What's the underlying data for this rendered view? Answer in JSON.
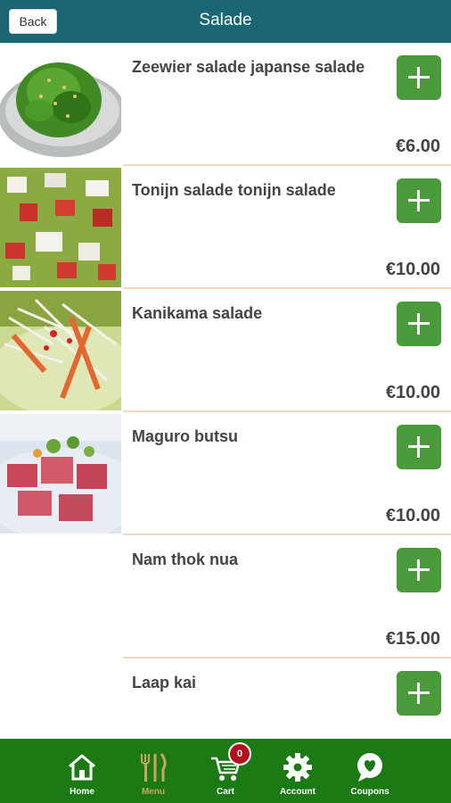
{
  "header": {
    "back_label": "Back",
    "title": "Salade",
    "bar_color": "#1b6675"
  },
  "items": [
    {
      "name": "Zeewier salade japanse salade",
      "price": "€6.00",
      "image": "seaweed-salad-image"
    },
    {
      "name": "Tonijn salade tonijn salade",
      "price": "€10.00",
      "image": "tuna-salad-image"
    },
    {
      "name": "Kanikama salade",
      "price": "€10.00",
      "image": "kanikama-salad-image"
    },
    {
      "name": "Maguro butsu",
      "price": "€10.00",
      "image": "maguro-butsu-image"
    },
    {
      "name": "Nam thok nua",
      "price": "€15.00"
    },
    {
      "name": "Laap kai",
      "price": ""
    }
  ],
  "nav": {
    "bar_color": "#1b7a14",
    "active_color": "#c9a46b",
    "tabs": [
      {
        "label": "Home",
        "icon": "home-icon"
      },
      {
        "label": "Menu",
        "icon": "fork-knife-icon"
      },
      {
        "label": "Cart",
        "icon": "cart-icon",
        "badge": "0"
      },
      {
        "label": "Account",
        "icon": "gear-icon"
      },
      {
        "label": "Coupons",
        "icon": "heart-chat-icon"
      }
    ]
  }
}
